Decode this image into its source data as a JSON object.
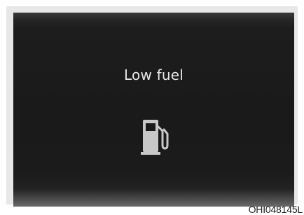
{
  "display": {
    "message": "Low fuel",
    "icon": "fuel-pump-icon",
    "text_color": "#e6e6e6",
    "icon_color": "#c8c8c8",
    "background_color": "#1a1a1a"
  },
  "figure": {
    "reference_code": "OHI048145L"
  }
}
